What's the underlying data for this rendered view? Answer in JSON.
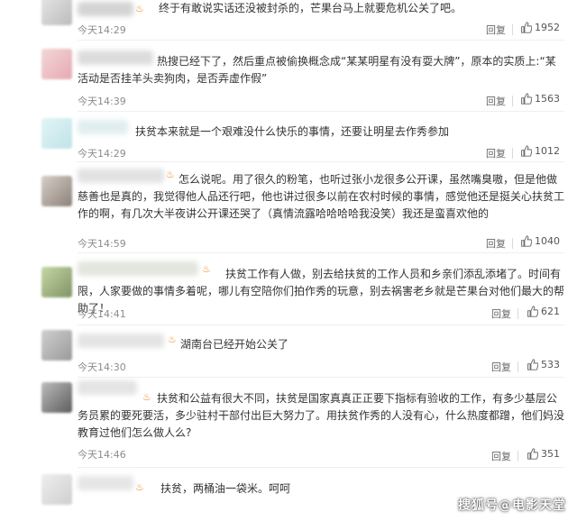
{
  "comments": [
    {
      "text": "终于有敢说实话还没被封杀的，芒果台马上就要危机公关了吧。",
      "time": "今天14:29",
      "reply": "回复",
      "likes": "1952"
    },
    {
      "text": "热搜已经下了，然后重点被偷换概念成“某某明星有没有耍大牌”，原本的实质上:“某活动是否挂羊头卖狗肉，是否弄虚作假”",
      "time": "今天14:39",
      "reply": "回复",
      "likes": "1563"
    },
    {
      "text": "扶贫本来就是一个艰难没什么快乐的事情，还要让明星去作秀参加",
      "time": "今天14:29",
      "reply": "回复",
      "likes": "1012"
    },
    {
      "text": "怎么说呢。用了很久的粉笔，也听过张小龙很多公开课，虽然嘴臭嗷，但是他做慈善也是真的，我觉得他人品还行吧，他也讲过很多以前在农村时候的事情，感觉他还是挺关心扶贫工作的啊，有几次大半夜讲公开课还哭了（真情流露哈哈哈哈我没笑）我还是蛮喜欢他的",
      "time": "今天14:59",
      "reply": "回复",
      "likes": "1040"
    },
    {
      "text": "扶贫工作有人做，别去给扶贫的工作人员和乡亲们添乱添堵了。时间有限，人家要做的事情多着呢，哪儿有空陪你们拍作秀的玩意，别去祸害老乡就是芒果台对他们最大的帮助了！",
      "time": "今天14:41",
      "reply": "回复",
      "likes": "621"
    },
    {
      "text": "湖南台已经开始公关了",
      "time": "今天14:30",
      "reply": "回复",
      "likes": "533"
    },
    {
      "text": "扶贫和公益有很大不同，扶贫是国家真真正正要下指标有验收的工作，有多少基层公务员累的要死要活，多少驻村干部付出巨大努力了。用扶贫作秀的人没有心，什么热度都蹭，他们妈没教育过他们怎么做人么?",
      "time": "今天14:46",
      "reply": "回复",
      "likes": "351"
    },
    {
      "text": "扶贫，两桶油一袋米。呵呵",
      "time": "",
      "reply": "",
      "likes": ""
    }
  ],
  "watermark": "搜狐号@电影天堂",
  "colors": {
    "flame": "#f08a24",
    "time": "#8c8c8c",
    "text": "#333333"
  }
}
